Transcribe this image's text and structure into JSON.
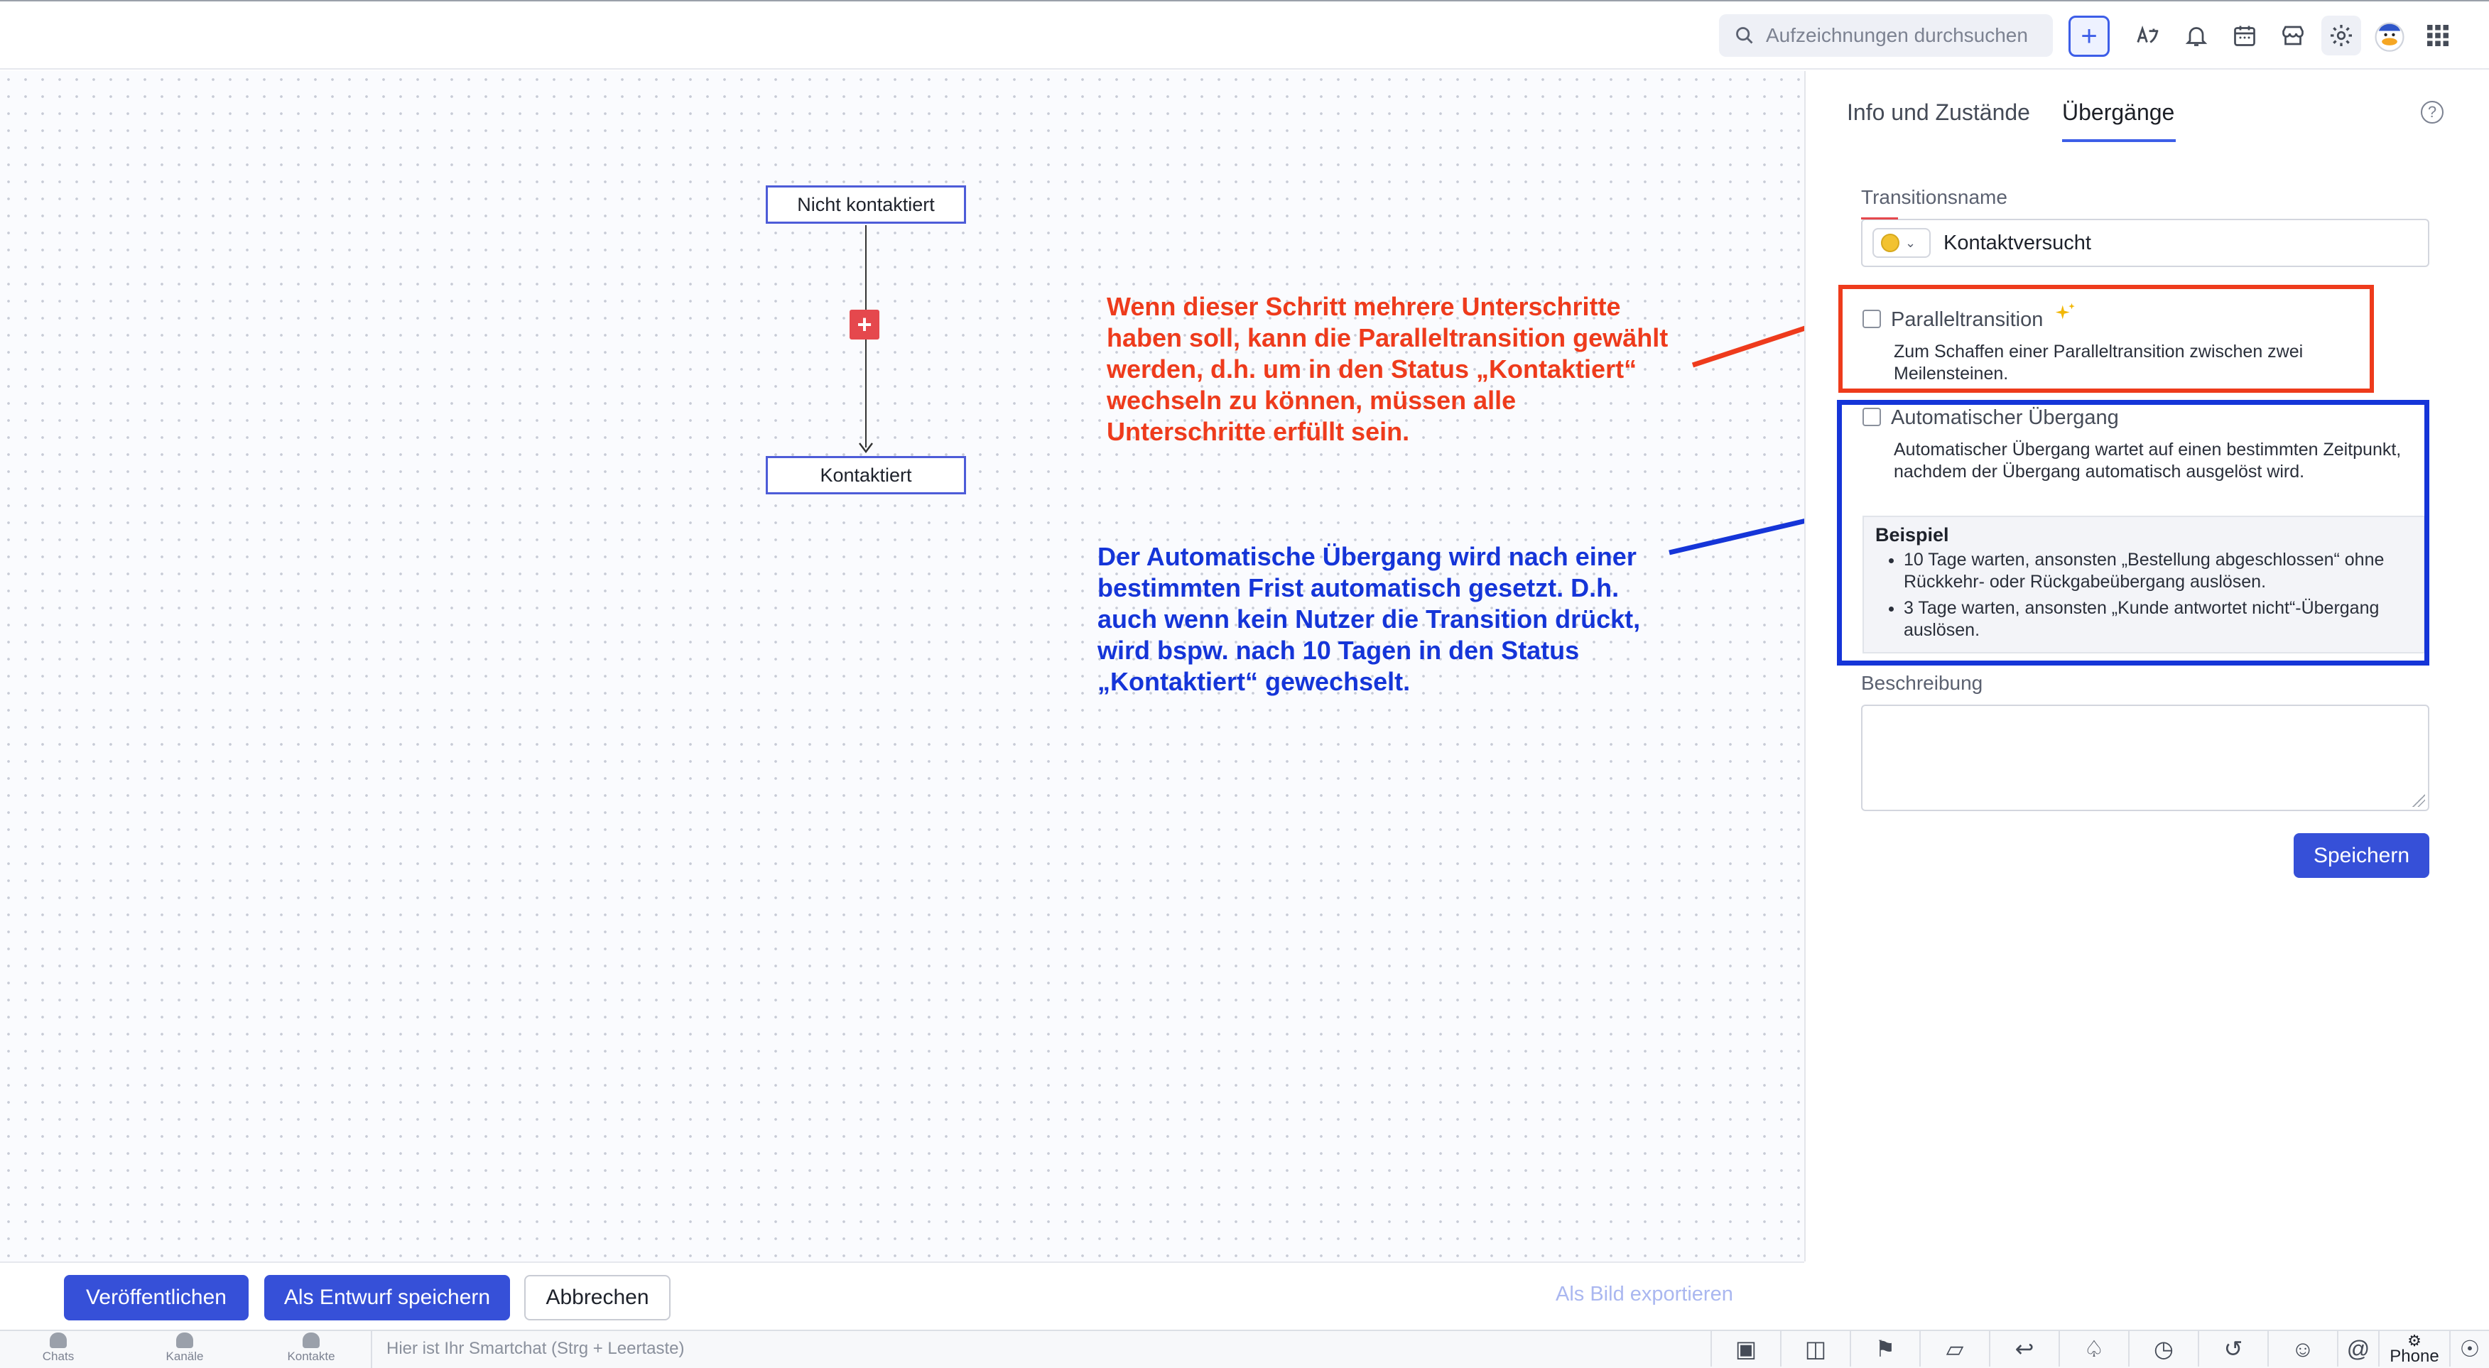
{
  "search": {
    "placeholder": "Aufzeichnungen durchsuchen"
  },
  "tabs": [
    {
      "label": "Info und Zustände"
    },
    {
      "label": "Übergänge"
    }
  ],
  "flow": {
    "nodes": [
      {
        "label": "Nicht kontaktiert"
      },
      {
        "label": "Kontaktiert"
      }
    ]
  },
  "annotations": {
    "red": "Wenn dieser Schritt mehrere Unterschritte haben soll, kann die Paralleltransition gewählt werden, d.h. um in den Status „Kontaktiert“ wechseln zu können, müssen alle Unterschritte erfüllt sein.",
    "blue": "Der Automatische Übergang wird nach einer bestimmten Frist automatisch gesetzt. D.h. auch wenn kein Nutzer die Transition drückt, wird bspw. nach 10 Tagen in den Status „Kontaktiert“ gewechselt."
  },
  "form": {
    "transition_label": "Transitionsname",
    "transition_value": "Kontaktversucht",
    "parallel": {
      "label": "Paralleltransition",
      "desc": "Zum Schaffen einer Paralleltransition zwischen zwei Meilensteinen."
    },
    "auto": {
      "label": "Automatischer Übergang",
      "desc": "Automatischer Übergang wartet auf einen bestimmten Zeitpunkt, nachdem der Übergang automatisch ausgelöst wird.",
      "example_title": "Beispiel",
      "examples": [
        "10 Tage warten, ansonsten „Bestellung abgeschlossen“ ohne Rückkehr- oder Rückgabeübergang auslösen.",
        "3 Tage warten, ansonsten „Kunde antwortet nicht“-Übergang auslösen."
      ]
    },
    "description_label": "Beschreibung",
    "save": "Speichern"
  },
  "footer": {
    "publish": "Veröffentlichen",
    "draft": "Als Entwurf speichern",
    "cancel": "Abbrechen",
    "export": "Als Bild exportieren"
  },
  "bottombar": {
    "nav": [
      "Chats",
      "Kanäle",
      "Kontakte"
    ],
    "smartchat": "Hier ist Ihr Smartchat (Strg + Leertaste)",
    "phone": "Phone"
  },
  "colors": {
    "accent": "#3650d8",
    "annotation_red": "#ee3b1c",
    "annotation_blue": "#1535d8",
    "node_border": "#4d5cd8"
  }
}
